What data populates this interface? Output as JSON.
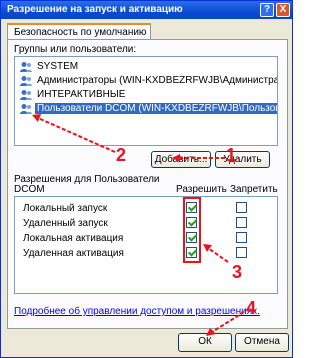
{
  "window": {
    "title": "Разрешение на запуск и активацию",
    "help": "?",
    "close": "X"
  },
  "tabs": [
    {
      "label": "Безопасность по умолчанию"
    }
  ],
  "groups": {
    "label": "Группы или пользователи:",
    "items": [
      {
        "label": "SYSTEM",
        "icon": "users-icon"
      },
      {
        "label": "Администраторы (WIN-KXDBEZRFWJB\\Администратор...",
        "icon": "users-icon"
      },
      {
        "label": "ИНТЕРАКТИВНЫЕ",
        "icon": "users-icon"
      },
      {
        "label": "Пользователи DCOM (WIN-KXDBEZRFWJB\\Пользоват...",
        "icon": "users-icon",
        "selected": true
      }
    ]
  },
  "buttons": {
    "add": "Добавить...",
    "remove": "Удалить",
    "ok": "ОК",
    "cancel": "Отмена"
  },
  "permissions": {
    "label_line1": "Разрешения для Пользователи",
    "label_line2": "DCOM",
    "allow_header": "Разрешить",
    "deny_header": "Запретить",
    "rows": [
      {
        "name": "Локальный запуск",
        "allow": true,
        "deny": false
      },
      {
        "name": "Удаленный запуск",
        "allow": true,
        "deny": false
      },
      {
        "name": "Локальная активация",
        "allow": true,
        "deny": false
      },
      {
        "name": "Удаленная активация",
        "allow": true,
        "deny": false
      }
    ]
  },
  "link": "Подробнее об управлении доступом и разрешениях.",
  "annotations": {
    "n1": "1",
    "n2": "2",
    "n3": "3",
    "n4": "4",
    "color": "#e8141c"
  }
}
